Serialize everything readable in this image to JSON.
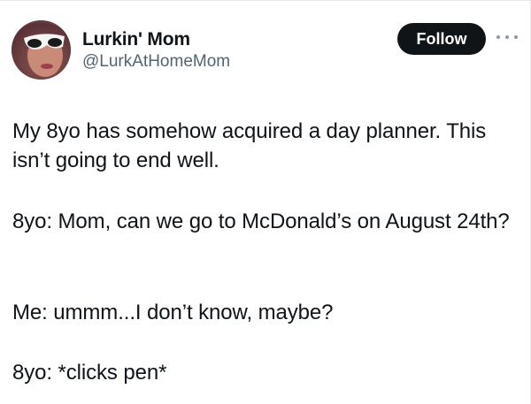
{
  "author": {
    "display_name": "Lurkin' Mom",
    "handle": "@LurkAtHomeMom"
  },
  "actions": {
    "follow_label": "Follow",
    "more_icon": "more-horizontal-icon"
  },
  "tweet": {
    "paragraphs": [
      "My 8yo has somehow acquired a day planner. This isn’t going to end well.",
      "8yo: Mom, can we go to McDonald’s on August 24th?",
      "Me: ummm...I don’t know, maybe?",
      "8yo: *clicks pen*"
    ]
  },
  "colors": {
    "text": "#0f1419",
    "secondary_text": "#536471",
    "follow_bg": "#0f1419",
    "follow_text": "#ffffff"
  }
}
